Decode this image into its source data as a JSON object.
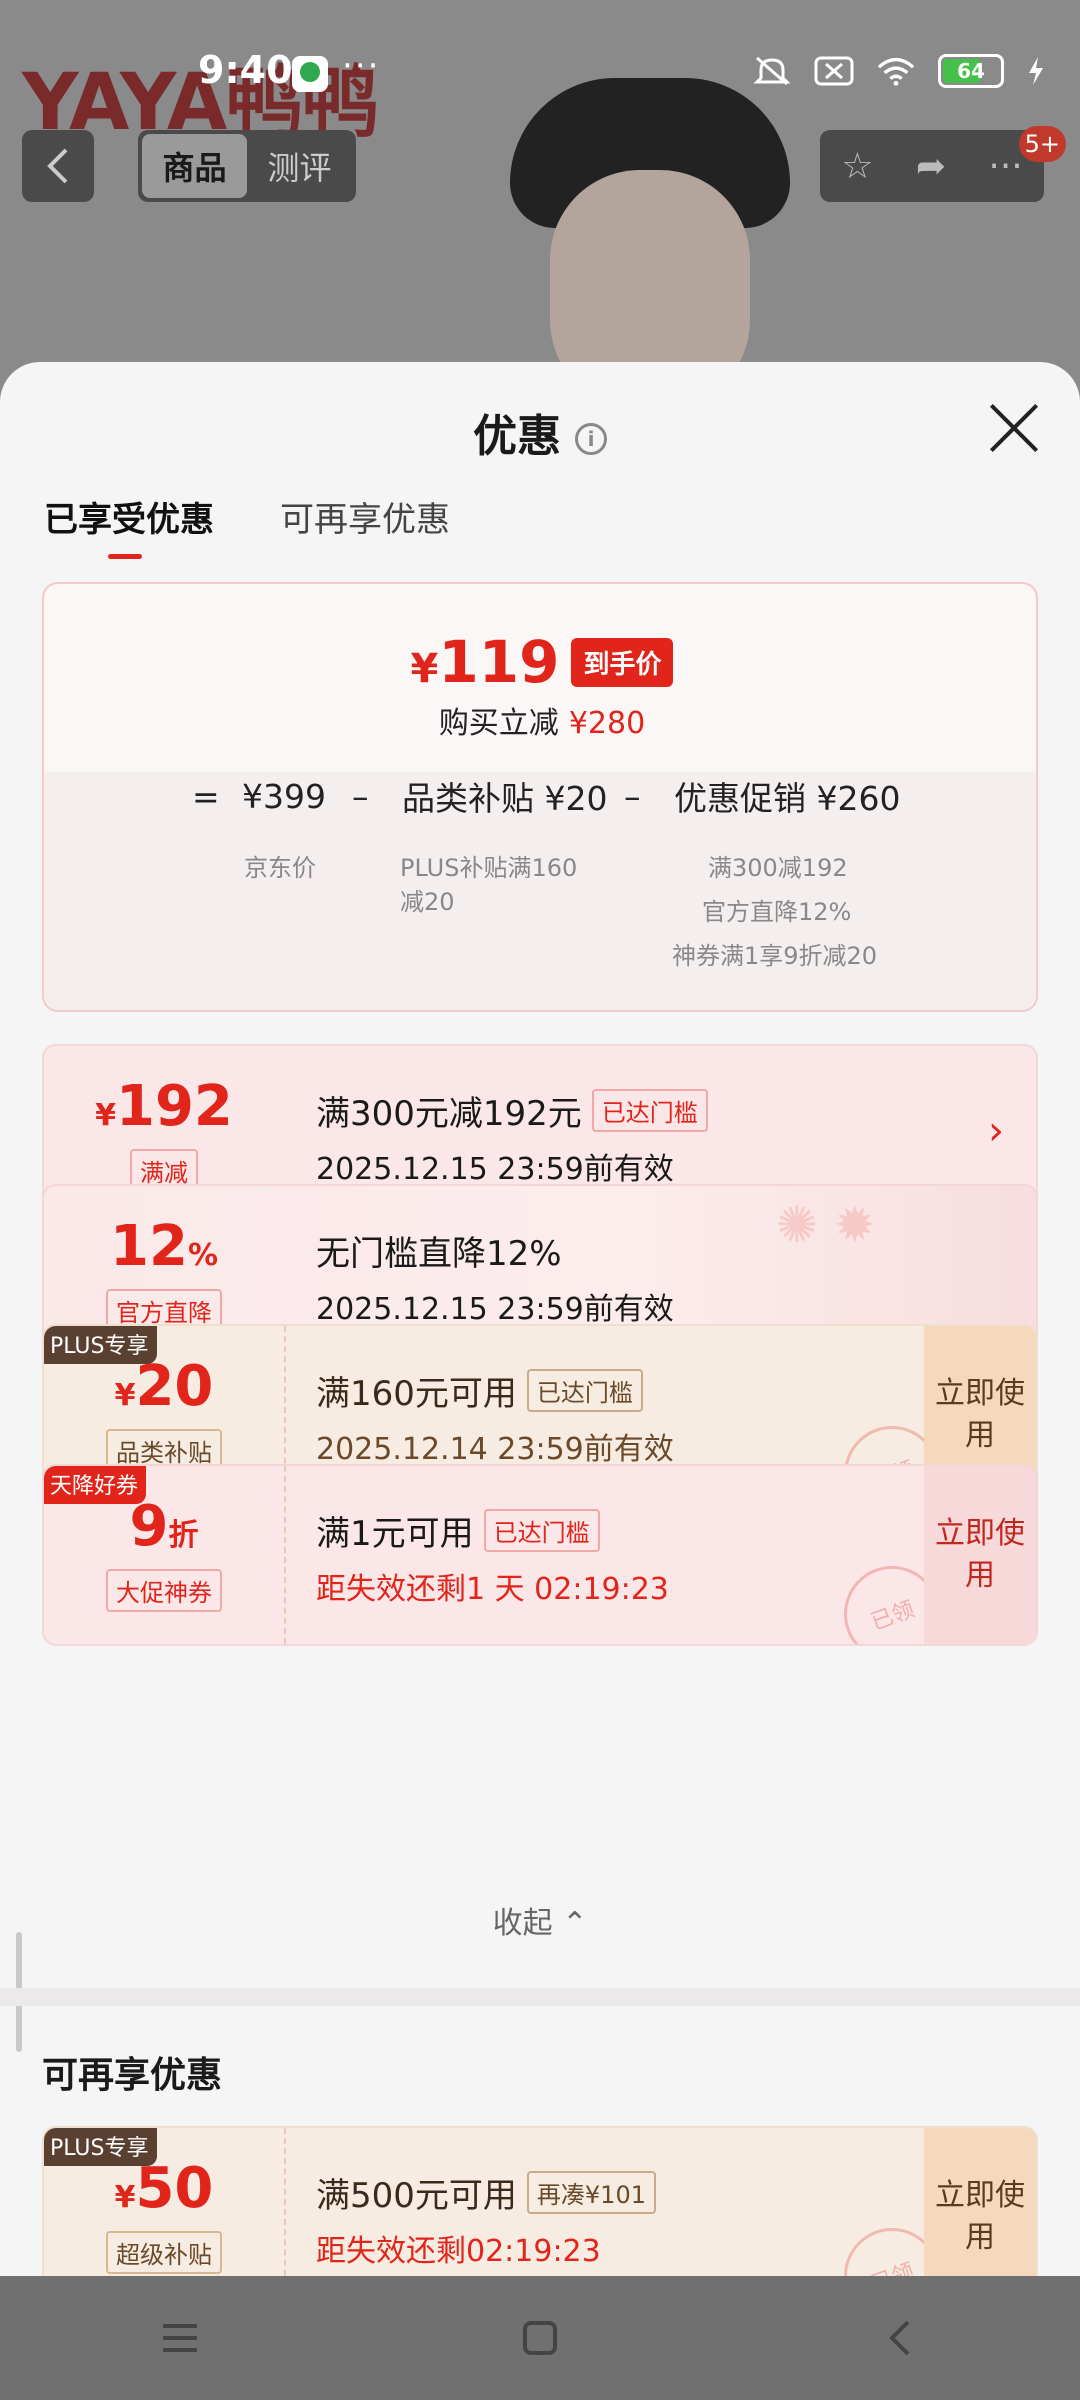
{
  "status": {
    "time": "9:40",
    "battery": "64"
  },
  "bg": {
    "brand": "YAYA鸭鸭",
    "tab_product": "商品",
    "tab_review": "测评",
    "badge": "5+"
  },
  "sheet": {
    "title": "优惠",
    "tabs": [
      "已享受优惠",
      "可再享优惠"
    ],
    "summary": {
      "final_price_symbol": "¥",
      "final_price": "119",
      "final_tag": "到手价",
      "reduce_label": "购买立减",
      "reduce_value": "¥280",
      "eq": "=",
      "jd_price": "¥399",
      "minus": "–",
      "category": "品类补贴 ¥20",
      "promo": "优惠促销 ¥260",
      "jd_label": "京东价",
      "category_sub1": "PLUS补贴满160",
      "category_sub2": "减20",
      "promo_sub1": "满300减192",
      "promo_sub2": "官方直降12%",
      "promo_sub3": "神券满1享9折减20"
    },
    "coupons": [
      {
        "symbol": "¥",
        "amount": "192",
        "kind": "满减",
        "title": "满300元减192元",
        "met": "已达门槛",
        "desc": "2025.12.15 23:59前有效"
      },
      {
        "amount": "12",
        "unit": "%",
        "kind": "官方直降",
        "title": "无门槛直降12%",
        "desc": "2025.12.15 23:59前有效"
      },
      {
        "corner": "PLUS专享",
        "symbol": "¥",
        "amount": "20",
        "kind": "品类补贴",
        "title": "满160元可用",
        "met": "已达门槛",
        "desc": "2025.12.14 23:59前有效",
        "use": "立即使用",
        "stamp": "已领"
      },
      {
        "corner": "天降好券",
        "amount": "9",
        "unit": "折",
        "kind": "大促神券",
        "title": "满1元可用",
        "met": "已达门槛",
        "desc": "距失效还剩1 天 02:19:23",
        "use": "立即使用",
        "stamp": "已领"
      }
    ],
    "collapse": "收起",
    "section2_title": "可再享优惠",
    "more_coupon": {
      "corner": "PLUS专享",
      "symbol": "¥",
      "amount": "50",
      "kind": "超级补贴",
      "title": "满500元可用",
      "met": "再凑¥101",
      "desc": "距失效还剩02:19:23",
      "use": "立即使用",
      "stamp": "已领"
    }
  },
  "colors": {
    "accent": "#e1251b",
    "gold": "#f5d9bd"
  }
}
